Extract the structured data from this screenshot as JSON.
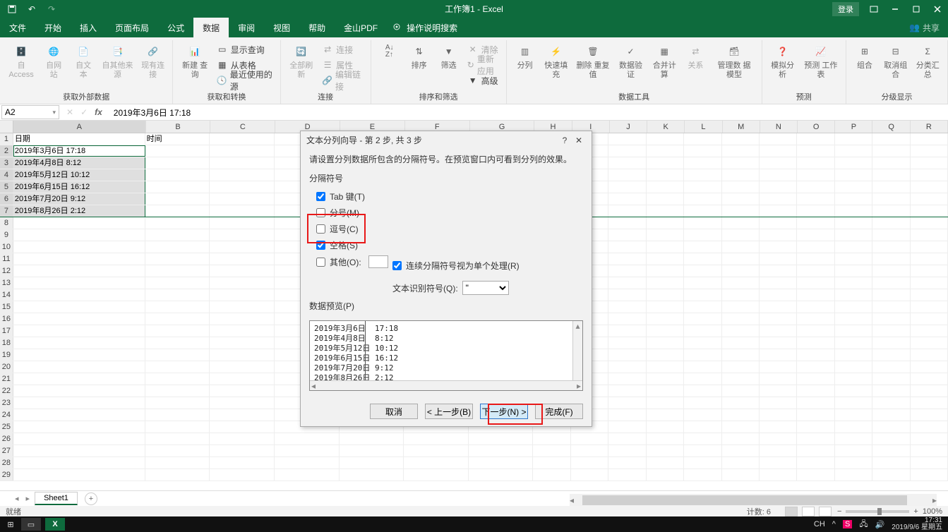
{
  "titlebar": {
    "title": "工作簿1 - Excel",
    "login": "登录"
  },
  "tabs": {
    "file": "文件",
    "items": [
      "开始",
      "插入",
      "页面布局",
      "公式",
      "数据",
      "审阅",
      "视图",
      "帮助",
      "金山PDF"
    ],
    "activeIndex": 4,
    "tellme": "操作说明搜索",
    "share": "共享"
  },
  "ribbon": {
    "groups": {
      "ext": {
        "label": "获取外部数据",
        "items": [
          "自 Access",
          "自网站",
          "自文本",
          "自其他来源",
          "现有连接"
        ]
      },
      "getTransform": {
        "label": "获取和转换",
        "newquery": "新建\n查询",
        "show": "显示查询",
        "fromTable": "从表格",
        "recent": "最近使用的源"
      },
      "conn": {
        "label": "连接",
        "refresh": "全部刷新",
        "connections": "连接",
        "props": "属性",
        "editlinks": "编辑链接"
      },
      "sortfilter": {
        "label": "排序和筛选",
        "sortAZ": "A↓Z",
        "sort": "排序",
        "filter": "筛选",
        "clear": "清除",
        "reapply": "重新应用",
        "adv": "高级"
      },
      "datatools": {
        "label": "数据工具",
        "split": "分列",
        "flash": "快速填充",
        "dedup": "删除\n重复值",
        "datavalid": "数据验\n证",
        "consolidate": "合并计算",
        "relations": "关系",
        "managedm": "管理数\n据模型"
      },
      "forecast": {
        "label": "预测",
        "whatif": "模拟分析",
        "forecast": "预测\n工作表"
      },
      "outline": {
        "label": "分级显示",
        "group": "组合",
        "ungroup": "取消组合",
        "subtotal": "分类汇总"
      }
    }
  },
  "formulaBar": {
    "name": "A2",
    "value": "2019年3月6日 17:18"
  },
  "sheet": {
    "headers": {
      "A": "日期",
      "B": "时间"
    },
    "columns": [
      "A",
      "B",
      "C",
      "D",
      "E",
      "F",
      "G",
      "H",
      "I",
      "J",
      "K",
      "L",
      "M",
      "N",
      "O",
      "P",
      "Q",
      "R"
    ],
    "rows": [
      {
        "n": 1,
        "A": "日期",
        "B": "时间"
      },
      {
        "n": 2,
        "A": "2019年3月6日 17:18"
      },
      {
        "n": 3,
        "A": "2019年4月8日 8:12"
      },
      {
        "n": 4,
        "A": "2019年5月12日 10:12"
      },
      {
        "n": 5,
        "A": "2019年6月15日 16:12"
      },
      {
        "n": 6,
        "A": "2019年7月20日 9:12"
      },
      {
        "n": 7,
        "A": "2019年8月26日 2:12"
      }
    ],
    "extraRows": 22,
    "selectedRows": [
      2,
      3,
      4,
      5,
      6,
      7
    ]
  },
  "dialog": {
    "title": "文本分列向导 - 第 2 步, 共 3 步",
    "desc": "请设置分列数据所包含的分隔符号。在预览窗口内可看到分列的效果。",
    "delimLabel": "分隔符号",
    "tab": "Tab 键(T)",
    "semicolon": "分号(M)",
    "comma": "逗号(C)",
    "space": "空格(S)",
    "other": "其他(O):",
    "mergeDelims": "连续分隔符号视为单个处理(R)",
    "textQualifier": "文本识别符号(Q):",
    "qualifierValue": "\"",
    "previewLabel": "数据预览(P)",
    "previewLines": [
      "2019年3月6日  17:18",
      "2019年4月8日  8:12",
      "2019年5月12日 10:12",
      "2019年6月15日 16:12",
      "2019年7月20日 9:12",
      "2019年8月26日 2:12"
    ],
    "buttons": {
      "cancel": "取消",
      "back": "< 上一步(B)",
      "next": "下一步(N) >",
      "finish": "完成(F)"
    }
  },
  "sheetTabs": {
    "sheet1": "Sheet1"
  },
  "statusBar": {
    "ready": "就绪",
    "count": "计数: 6",
    "zoom": "100%"
  },
  "taskbar": {
    "ime": "CH",
    "time": "17:31",
    "date": "2019/9/6 星期五"
  }
}
